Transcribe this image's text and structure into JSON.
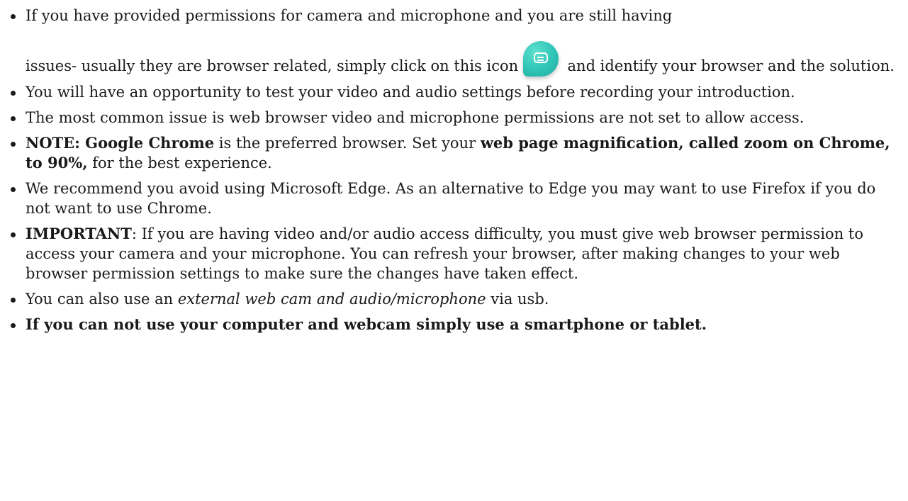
{
  "bullets": {
    "b1": {
      "line1": "If you have provided permissions for camera and microphone and you are still having",
      "before_icon": "issues- usually they are browser related, simply click on this icon",
      "icon": "chat-bubble-icon",
      "after_icon": " and identify your browser and the solution."
    },
    "b2": {
      "text": "You will have an opportunity to test your video and audio settings before recording your introduction."
    },
    "b3": {
      "text": "The most common issue is web browser video and microphone permissions are not set to allow access."
    },
    "b4": {
      "bold1": "NOTE: Google Chrome",
      "mid": " is the preferred browser. Set your ",
      "bold2": "web page magnification, called zoom on Chrome, to 90%,",
      "end": " for the best experience."
    },
    "b5": {
      "text": "We recommend you avoid using Microsoft Edge. As an alternative to Edge you may want to use Firefox if you do not want to use Chrome."
    },
    "b6": {
      "bold": "IMPORTANT",
      "rest": ": If you are having video and/or audio access difficulty, you must give web browser permission to access your camera and your microphone. You can refresh your browser, after making changes to your web browser permission settings to make sure the changes have taken effect."
    },
    "b7": {
      "start": "You can also use an ",
      "italic": "external web cam and audio/microphone",
      "end": " via usb."
    },
    "b8": {
      "bold": "If you can not use your computer and webcam simply use a smartphone or tablet."
    }
  },
  "colors": {
    "icon_teal": "#2ec4b6",
    "text": "#1a1a1a"
  }
}
